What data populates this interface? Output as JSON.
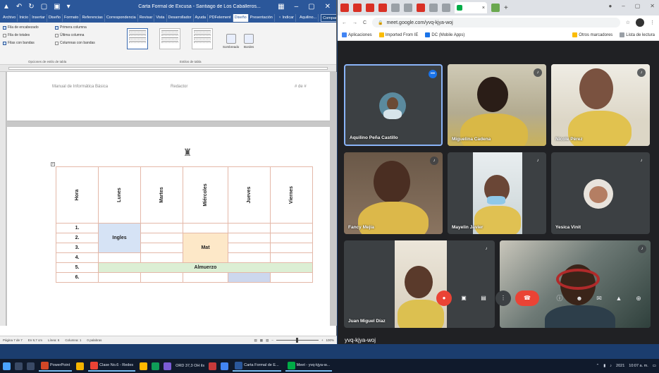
{
  "word": {
    "title": "Carta Formal de Excusa - Santiago de Los Caballeros...",
    "tabs": [
      "Archivo",
      "Inicio",
      "Insertar",
      "Diseño",
      "Formato",
      "Referencias",
      "Correspondencia",
      "Revisar",
      "Vista",
      "Desarrollador",
      "Ayuda",
      "PDFelement",
      "Diseño",
      "Presentación"
    ],
    "active_tab_index": 12,
    "tab_tell": "♀ Indicar",
    "tab_user": "Aquilino...",
    "tab_share": "Compartir",
    "checks": [
      {
        "label": "Fila de encabezado",
        "on": true
      },
      {
        "label": "Fila de totales",
        "on": false
      },
      {
        "label": "Filas con bandas",
        "on": true
      },
      {
        "label": "Primera columna",
        "on": true
      },
      {
        "label": "Última columna",
        "on": false
      },
      {
        "label": "Columnas con bandas",
        "on": false
      }
    ],
    "group1_label": "Opciones de estilo de tabla",
    "group2_label": "Estilos de tabla",
    "shading_label": "Sombreado",
    "borders_label": "Bordes",
    "header_left": "Manual de Informática Básica",
    "header_mid": "Redactor",
    "header_right": "# de #",
    "logo_glyph": "♜",
    "handle_glyph": "+",
    "table": {
      "headers": [
        "Hora",
        "Lunes",
        "Martes",
        "Miércoles",
        "Jueves",
        "Viernes"
      ],
      "rows": [
        "1.",
        "2.",
        "3.",
        "4.",
        "5.",
        "6."
      ],
      "ingles": "Ingles",
      "mat": "Mat",
      "almuerzo": "Almuerzo"
    },
    "status": {
      "page": "Página 7 de 7",
      "pos": "En 9,7 cm",
      "line": "Línea: 6",
      "col": "Columna: 1",
      "words": "0 palabras",
      "zoom": "100%"
    }
  },
  "chrome": {
    "tab_close": "×",
    "new_tab": "+",
    "url": "meet.google.com/yvq-kjya-woj",
    "nav_back": "←",
    "nav_fwd": "→",
    "nav_reload": "C",
    "lock": "🔒",
    "star": "☆",
    "menu": "⋮",
    "bookmarks": [
      "Aplicaciones",
      "Imported From IE",
      "DC (Mobile Apps)",
      "Otros marcadores",
      "Lista de lectura"
    ]
  },
  "meet": {
    "participants": [
      {
        "name": "Aquilino Peña Castillo"
      },
      {
        "name": "Miguelina Cadena"
      },
      {
        "name": "Nicole Pérez"
      },
      {
        "name": "Fancy Mejía"
      },
      {
        "name": "Mayelin Javier"
      },
      {
        "name": "Yesica Vinit"
      },
      {
        "name": "Juan Miguel Díaz"
      },
      {
        "name": ""
      }
    ],
    "meeting_code": "yvq-kjya-woj",
    "more_glyph": "•••",
    "mic_glyph": "♪"
  },
  "taskbar": {
    "apps": [
      "PowerPoint",
      "Clase No.6 - Redes",
      "Carta Formal de E...",
      "Meet - yvq-kjya-w..."
    ],
    "status_text": "ORD 37,3 OH ils",
    "time": "10:07 a. m.",
    "date": "2021"
  }
}
